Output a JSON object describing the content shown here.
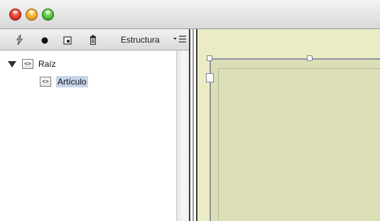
{
  "window": {
    "traffic_lights": [
      "close",
      "minimize",
      "zoom"
    ],
    "colors": {
      "close": "#e0392b",
      "minimize": "#f0a92b",
      "zoom": "#4cbf3a"
    }
  },
  "structure_panel": {
    "toolbar": {
      "icons": [
        "lightning-icon",
        "record-dot-icon",
        "new-element-icon",
        "trash-icon"
      ],
      "title": "Estructura",
      "menu_icon": "panel-menu-icon"
    },
    "tree": [
      {
        "label": "Raíz",
        "expanded": true,
        "selected": false,
        "icon": "xml-tag-icon",
        "tag_glyph": "<>"
      },
      {
        "label": "Artículo",
        "expanded": false,
        "selected": true,
        "icon": "xml-tag-icon",
        "tag_glyph": "<>"
      }
    ],
    "selection_color": "#c7d4ea"
  },
  "canvas": {
    "background_color": "#ebecc3",
    "frame_color": "#dcdfb6",
    "frame_border_color": "#8d91a6"
  }
}
